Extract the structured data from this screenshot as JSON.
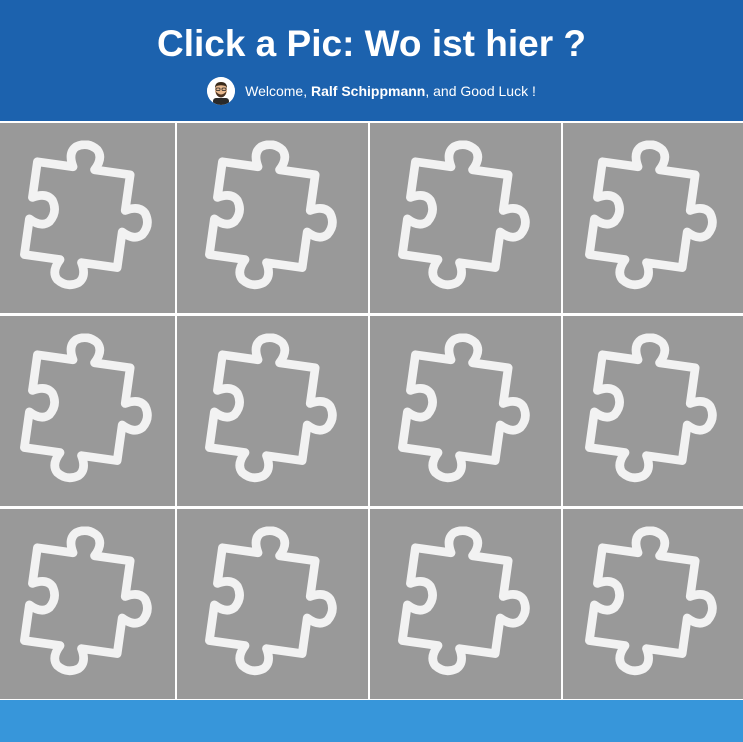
{
  "header": {
    "title": "Click a Pic: Wo ist hier ?",
    "welcome_prefix": "Welcome, ",
    "user_name": "Ralf Schippmann",
    "welcome_suffix": ", and Good Luck !",
    "avatar_icon": "user-avatar-icon"
  },
  "grid": {
    "rows": 3,
    "columns": 4,
    "tile_icon": "puzzle-piece-icon",
    "tiles": [
      {
        "row": 1,
        "col": 1
      },
      {
        "row": 1,
        "col": 2
      },
      {
        "row": 1,
        "col": 3
      },
      {
        "row": 1,
        "col": 4
      },
      {
        "row": 2,
        "col": 1
      },
      {
        "row": 2,
        "col": 2
      },
      {
        "row": 2,
        "col": 3
      },
      {
        "row": 2,
        "col": 4
      },
      {
        "row": 3,
        "col": 1
      },
      {
        "row": 3,
        "col": 2
      },
      {
        "row": 3,
        "col": 3
      },
      {
        "row": 3,
        "col": 4
      }
    ]
  },
  "colors": {
    "header_bg": "#1c62ae",
    "tile_bg": "#999999",
    "puzzle_stroke": "#f2f2f2",
    "footer_bg": "#3796da"
  }
}
